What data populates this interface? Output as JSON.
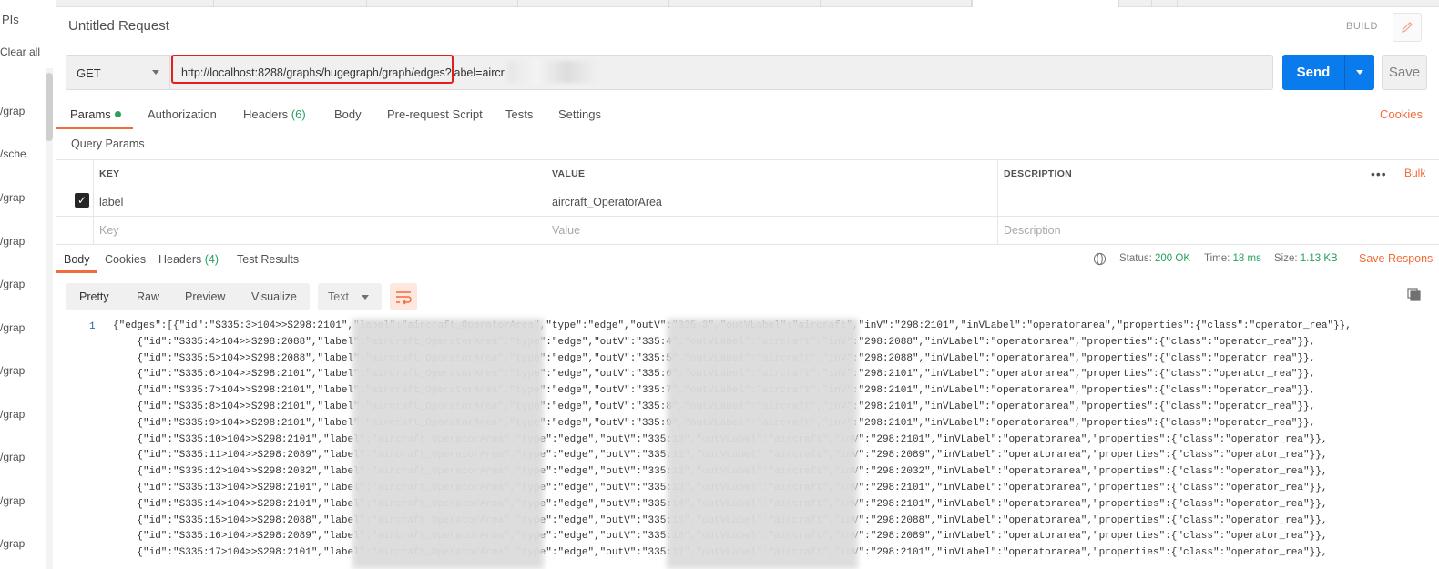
{
  "sidebar": {
    "apis_label": "PIs",
    "clear_all": "Clear all",
    "items": [
      "/grap",
      "/sche",
      "/grap",
      "/grap",
      "/grap",
      "/grap",
      "/grap",
      "/grap",
      "/grap",
      "/grap",
      "/grap"
    ]
  },
  "request": {
    "title": "Untitled Request",
    "build_label": "BUILD",
    "method": "GET",
    "url": "http://localhost:8288/graphs/hugegraph/graph/edges?label=aircr",
    "send_label": "Send",
    "save_label": "Save"
  },
  "request_tabs": [
    {
      "label": "Params"
    },
    {
      "label": "Authorization"
    },
    {
      "label": "Headers",
      "count": "(6)"
    },
    {
      "label": "Body"
    },
    {
      "label": "Pre-request Script"
    },
    {
      "label": "Tests"
    },
    {
      "label": "Settings"
    }
  ],
  "cookies_link": "Cookies",
  "query_params": {
    "section_label": "Query Params",
    "headers": {
      "key": "KEY",
      "value": "VALUE",
      "description": "DESCRIPTION"
    },
    "bulk_edit": "Bulk",
    "rows": [
      {
        "key": "label",
        "value": "aircraft_OperatorArea",
        "description": "",
        "checked": true
      }
    ],
    "placeholders": {
      "key": "Key",
      "value": "Value",
      "description": "Description"
    }
  },
  "response": {
    "tabs": [
      {
        "label": "Body"
      },
      {
        "label": "Cookies"
      },
      {
        "label": "Headers",
        "count": "(4)"
      },
      {
        "label": "Test Results"
      }
    ],
    "status_label": "Status:",
    "status_value": "200 OK",
    "time_label": "Time:",
    "time_value": "18 ms",
    "size_label": "Size:",
    "size_value": "1.13 KB",
    "save_response": "Save Respons",
    "formats": [
      "Pretty",
      "Raw",
      "Preview",
      "Visualize"
    ],
    "type_select": "Text",
    "line_number": "1",
    "lines": [
      "{\"edges\":[{\"id\":\"S335:3>104>>S298:2101\",\"label\":\"aircraft_OperatorArea\",\"type\":\"edge\",\"outV\":\"335:3\",\"outVLabel\":\"aircraft\",\"inV\":\"298:2101\",\"inVLabel\":\"operatorarea\",\"properties\":{\"class\":\"operator_rea\"}},",
      "    {\"id\":\"S335:4>104>>S298:2088\",\"label\":\"aircraft_OperatorArea\",\"type\":\"edge\",\"outV\":\"335:4\",\"outVLabel\":\"aircraft\",\"inV\":\"298:2088\",\"inVLabel\":\"operatorarea\",\"properties\":{\"class\":\"operator_rea\"}},",
      "    {\"id\":\"S335:5>104>>S298:2088\",\"label\":\"aircraft_OperatorArea\",\"type\":\"edge\",\"outV\":\"335:5\",\"outVLabel\":\"aircraft\",\"inV\":\"298:2088\",\"inVLabel\":\"operatorarea\",\"properties\":{\"class\":\"operator_rea\"}},",
      "    {\"id\":\"S335:6>104>>S298:2101\",\"label\":\"aircraft_OperatorArea\",\"type\":\"edge\",\"outV\":\"335:6\",\"outVLabel\":\"aircraft\",\"inV\":\"298:2101\",\"inVLabel\":\"operatorarea\",\"properties\":{\"class\":\"operator_rea\"}},",
      "    {\"id\":\"S335:7>104>>S298:2101\",\"label\":\"aircraft_OperatorArea\",\"type\":\"edge\",\"outV\":\"335:7\",\"outVLabel\":\"aircraft\",\"inV\":\"298:2101\",\"inVLabel\":\"operatorarea\",\"properties\":{\"class\":\"operator_rea\"}},",
      "    {\"id\":\"S335:8>104>>S298:2101\",\"label\":\"aircraft_OperatorArea\",\"type\":\"edge\",\"outV\":\"335:8\",\"outVLabel\":\"aircraft\",\"inV\":\"298:2101\",\"inVLabel\":\"operatorarea\",\"properties\":{\"class\":\"operator_rea\"}},",
      "    {\"id\":\"S335:9>104>>S298:2101\",\"label\":\"aircraft_OperatorArea\",\"type\":\"edge\",\"outV\":\"335:9\",\"outVLabel\":\"aircraft\",\"inV\":\"298:2101\",\"inVLabel\":\"operatorarea\",\"properties\":{\"class\":\"operator_rea\"}},",
      "    {\"id\":\"S335:10>104>>S298:2101\",\"label\":\"aircraft_OperatorArea\",\"type\":\"edge\",\"outV\":\"335:10\",\"outVLabel\":\"aircraft\",\"inV\":\"298:2101\",\"inVLabel\":\"operatorarea\",\"properties\":{\"class\":\"operator_rea\"}},",
      "    {\"id\":\"S335:11>104>>S298:2089\",\"label\":\"aircraft_OperatorArea\",\"type\":\"edge\",\"outV\":\"335:11\",\"outVLabel\":\"aircraft\",\"inV\":\"298:2089\",\"inVLabel\":\"operatorarea\",\"properties\":{\"class\":\"operator_rea\"}},",
      "    {\"id\":\"S335:12>104>>S298:2032\",\"label\":\"aircraft_OperatorArea\",\"type\":\"edge\",\"outV\":\"335:12\",\"outVLabel\":\"aircraft\",\"inV\":\"298:2032\",\"inVLabel\":\"operatorarea\",\"properties\":{\"class\":\"operator_rea\"}},",
      "    {\"id\":\"S335:13>104>>S298:2101\",\"label\":\"aircraft_OperatorArea\",\"type\":\"edge\",\"outV\":\"335:13\",\"outVLabel\":\"aircraft\",\"inV\":\"298:2101\",\"inVLabel\":\"operatorarea\",\"properties\":{\"class\":\"operator_rea\"}},",
      "    {\"id\":\"S335:14>104>>S298:2101\",\"label\":\"aircraft_OperatorArea\",\"type\":\"edge\",\"outV\":\"335:14\",\"outVLabel\":\"aircraft\",\"inV\":\"298:2101\",\"inVLabel\":\"operatorarea\",\"properties\":{\"class\":\"operator_rea\"}},",
      "    {\"id\":\"S335:15>104>>S298:2088\",\"label\":\"aircraft_OperatorArea\",\"type\":\"edge\",\"outV\":\"335:15\",\"outVLabel\":\"aircraft\",\"inV\":\"298:2088\",\"inVLabel\":\"operatorarea\",\"properties\":{\"class\":\"operator_rea\"}},",
      "    {\"id\":\"S335:16>104>>S298:2089\",\"label\":\"aircraft_OperatorArea\",\"type\":\"edge\",\"outV\":\"335:16\",\"outVLabel\":\"aircraft\",\"inV\":\"298:2089\",\"inVLabel\":\"operatorarea\",\"properties\":{\"class\":\"operator_rea\"}},",
      "    {\"id\":\"S335:17>104>>S298:2101\",\"label\":\"aircraft_OperatorArea\",\"type\":\"edge\",\"outV\":\"335:17\",\"outVLabel\":\"aircraft\",\"inV\":\"298:2101\",\"inVLabel\":\"operatorarea\",\"properties\":{\"class\":\"operator_rea\"}},"
    ]
  },
  "colors": {
    "accent": "#f26b3a",
    "send": "#097bed",
    "success": "#26a05c",
    "highlight_box": "#e02020"
  }
}
